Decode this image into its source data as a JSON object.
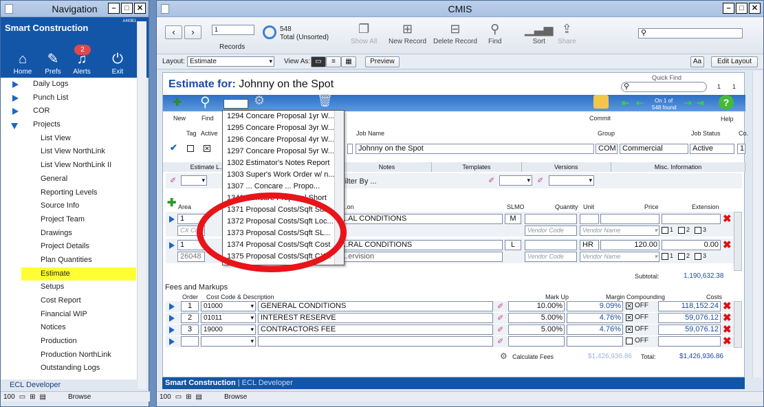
{
  "nav_window": {
    "title": "Navigation",
    "brand": "Smart Construction",
    "version": "A4I0B1",
    "buttons": [
      {
        "label": "Home",
        "icon": "home-icon"
      },
      {
        "label": "Prefs",
        "icon": "prefs-icon"
      },
      {
        "label": "Alerts",
        "icon": "bell-icon",
        "badge": "2"
      },
      {
        "label": "Exit",
        "icon": "power-icon"
      }
    ],
    "items": [
      {
        "label": "Daily Logs",
        "type": "parent"
      },
      {
        "label": "Punch List",
        "type": "parent"
      },
      {
        "label": "COR",
        "type": "parent"
      },
      {
        "label": "Projects",
        "type": "expanded"
      },
      {
        "label": "List View"
      },
      {
        "label": "List View NorthLink"
      },
      {
        "label": "List View NorthLink II"
      },
      {
        "label": "General"
      },
      {
        "label": "Reporting Levels"
      },
      {
        "label": "Source Info"
      },
      {
        "label": "Project Team"
      },
      {
        "label": "Drawings"
      },
      {
        "label": "Project Details"
      },
      {
        "label": "Plan Quantities"
      },
      {
        "label": "Estimate",
        "active": true
      },
      {
        "label": "Setups"
      },
      {
        "label": "Cost Report"
      },
      {
        "label": "Financial WIP"
      },
      {
        "label": "Notices"
      },
      {
        "label": "Production"
      },
      {
        "label": "Production NorthLink"
      },
      {
        "label": "Outstanding Logs"
      }
    ],
    "footer": "ECL Developer",
    "zoom": "100",
    "mode": "Browse"
  },
  "main_window": {
    "title": "CMIS",
    "record_current": "1",
    "records_label": "Records",
    "total_count": "548",
    "total_label": "Total (Unsorted)",
    "toolbar": [
      "Show All",
      "New Record",
      "Delete Record",
      "Find",
      "Sort",
      "Share"
    ],
    "layout_label": "Layout:",
    "layout_value": "Estimate",
    "viewas_label": "View As:",
    "preview_label": "Preview",
    "aa_label": "Aa",
    "edit_layout_label": "Edit Layout",
    "zoom": "100",
    "mode": "Browse",
    "status": "Smart Construction",
    "status_sub": "ECL Developer"
  },
  "estimate": {
    "heading_prefix": "Estimate for:",
    "heading_name": "Johnny on the Spot",
    "quick_find_label": "Quick Find",
    "qf_n1": "1",
    "qf_n2": "1",
    "icons": {
      "new": "New",
      "find": "Find",
      "commit": "Commit",
      "help": "Help"
    },
    "record_nav": "On 1 of",
    "record_found": "548 found",
    "headers": {
      "tag": "Tag",
      "active": "Active",
      "jobname": "Job Name",
      "group": "Group",
      "status": "Job Status",
      "co": "Co."
    },
    "job": {
      "name": "Johnny on the Spot",
      "group_code": "COM",
      "group": "Commercial",
      "status": "Active",
      "co": "1"
    },
    "tabs": [
      "Estimate L...",
      "",
      "Notes",
      "Templates",
      "Versions",
      "Misc. Information"
    ],
    "filter_label": "Filter By ...",
    "col_headers": {
      "area": "Area",
      "desc": "...on",
      "slmo": "SLMO",
      "qty": "Quantity",
      "unit": "Unit",
      "price": "Price",
      "ext": "Extension"
    },
    "lines": [
      {
        "area": "1",
        "cxcode": "CX Code",
        "desc": "...AL CONDITIONS",
        "slmo": "M",
        "unit": "",
        "price": "",
        "ext": "",
        "vendor_code": "Vendor Code",
        "vendor_name": "Vendor Name",
        "sub": ""
      },
      {
        "area": "1",
        "cxcode": "26048",
        "desc": "...RAL CONDITIONS",
        "slmo": "L",
        "unit": "HR",
        "price": "120.00",
        "ext": "0.00",
        "vendor_code": "Vendor Code",
        "vendor_name": "Vendor Name",
        "sub": "...ervision"
      }
    ],
    "check_labels": [
      "1",
      "2",
      "3"
    ],
    "subtotal_label": "Subtotal:",
    "subtotal": "1,190,632.38",
    "fees_title": "Fees and Markups",
    "fees_headers": {
      "order": "Order",
      "cost": "Cost Code & Description",
      "markup": "Mark Up",
      "margin": "Margin Compounding",
      "costs": "Costs"
    },
    "fees": [
      {
        "order": "1",
        "code": "01000",
        "desc": "GENERAL CONDITIONS",
        "markup": "10.00%",
        "margin": "9.09%",
        "comp": "OFF",
        "checked": true,
        "cost": "118,152.24"
      },
      {
        "order": "2",
        "code": "01011",
        "desc": "INTEREST RESERVE",
        "markup": "5.00%",
        "margin": "4.76%",
        "comp": "OFF",
        "checked": true,
        "cost": "59,076.12"
      },
      {
        "order": "3",
        "code": "19000",
        "desc": "CONTRACTORS FEE",
        "markup": "5.00%",
        "margin": "4.76%",
        "comp": "OFF",
        "checked": true,
        "cost": "59,076.12"
      },
      {
        "order": "",
        "code": "",
        "desc": "",
        "markup": "",
        "margin": "",
        "comp": "OFF",
        "checked": false,
        "cost": ""
      }
    ],
    "calc_fees_label": "Calculate Fees",
    "calc_value": "$1,426,936.86",
    "total_label": "Total:",
    "total_value": "$1,426,936.86"
  },
  "dropdown": [
    "1294 Concare Proposal 1yr W...",
    "1295 Concare Proposal 3yr W...",
    "1296 Concare Proposal 4yr W...",
    "1297 Concare Proposal 5yr W...",
    "1302 Estimator's Notes Report",
    "1303 Super's Work Order w/ n...",
    "1307 ... Concare ... Propo...",
    "1341 Concare Proposal Short",
    "1371 Proposal Costs/Sqft Sub...",
    "1372 Proposal Costs/Sqft Loc...",
    "1373 Proposal Costs/Sqft SL...",
    "1374 Proposal Costs/Sqft Cost",
    "1375 Proposal Costs/Sqft CX..."
  ],
  "colors": {
    "nav_blue": "#1356a8",
    "highlight": "#ffff33",
    "annotation": "#e8141a"
  }
}
